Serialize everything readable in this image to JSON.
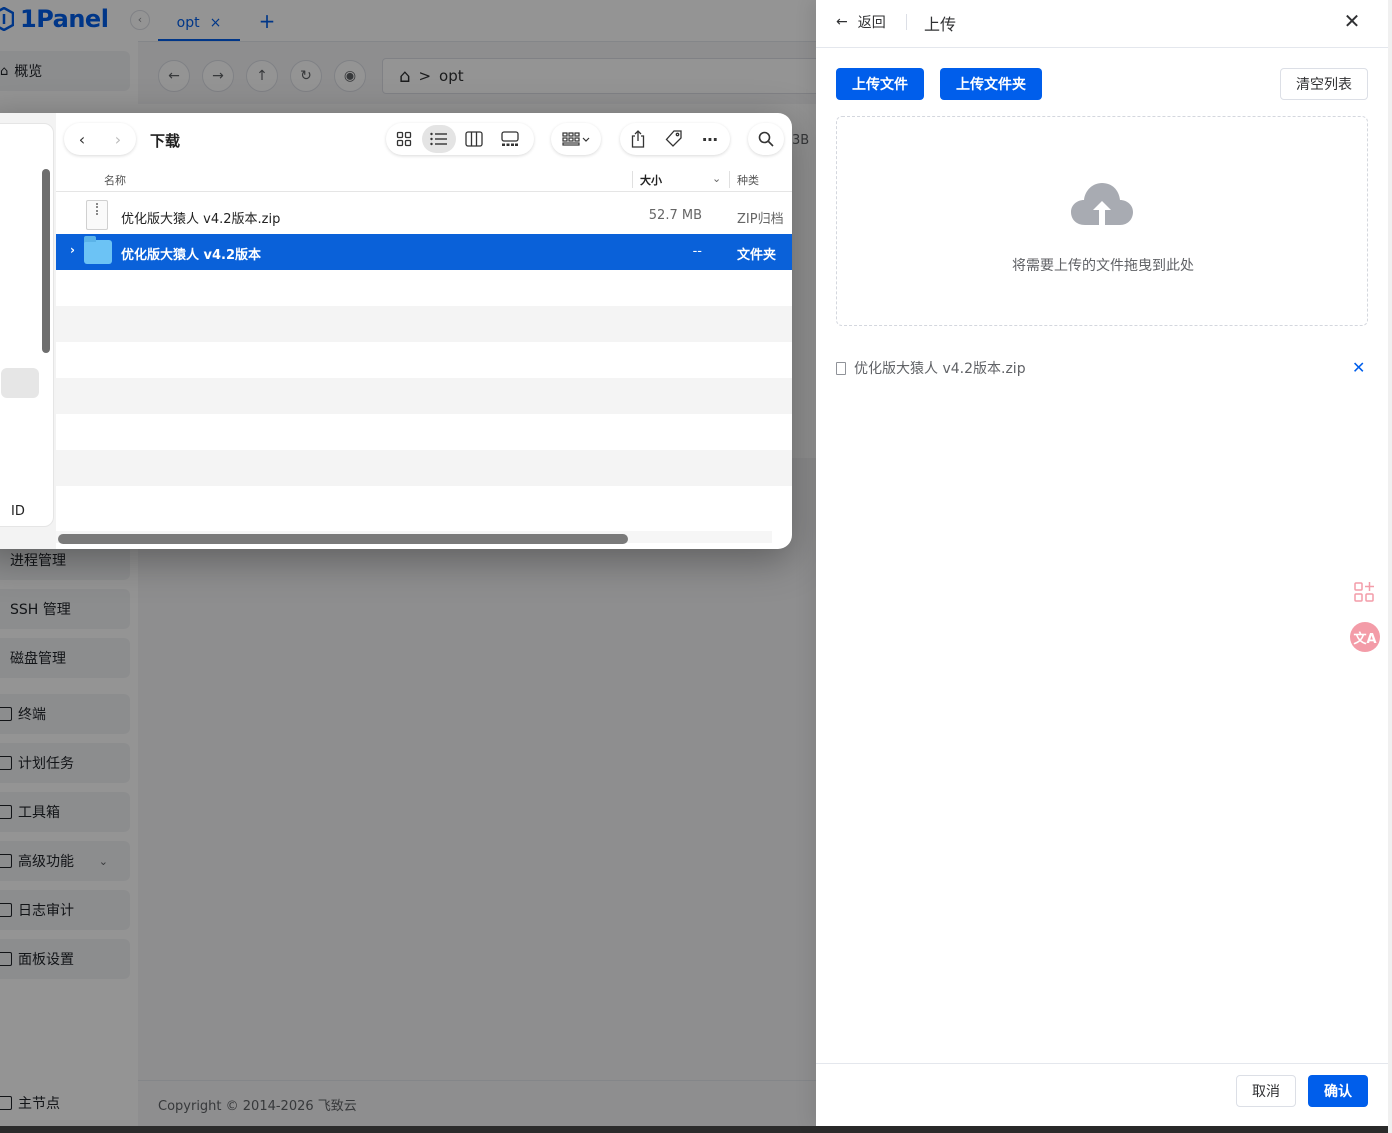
{
  "app": {
    "logo": "1Panel",
    "tab": {
      "label": "opt",
      "close": "×"
    },
    "tab_add": "+",
    "path": {
      "home": "⌂",
      "separator": ">",
      "folder": "opt"
    },
    "footer": "Copyright © 2014-2026 飞致云",
    "sidebar": {
      "overview": "概览",
      "process": "进程管理",
      "ssh": "SSH 管理",
      "disk": "磁盘管理",
      "terminal": "终端",
      "cron": "计划任务",
      "toolbox": "工具箱",
      "advanced": "高级功能",
      "log_audit": "日志审计",
      "settings": "面板设置",
      "master_node": "主节点"
    },
    "peek_size": "3B"
  },
  "finder": {
    "title": "下载",
    "sidebar_fragment": "ID",
    "columns": {
      "name": "名称",
      "size": "大小",
      "kind": "种类"
    },
    "rows": [
      {
        "name": "优化版大猿人 v4.2版本.zip",
        "size": "52.7 MB",
        "kind": "ZIP归档"
      },
      {
        "name": "优化版大猿人 v4.2版本",
        "size": "--",
        "kind": "文件夹"
      }
    ]
  },
  "drawer": {
    "back": "返回",
    "title": "上传",
    "upload_file": "上传文件",
    "upload_folder": "上传文件夹",
    "clear_list": "清空列表",
    "drop_hint": "将需要上传的文件拖曳到此处",
    "files": [
      {
        "name": "优化版大猿人 v4.2版本.zip"
      }
    ],
    "cancel": "取消",
    "confirm": "确认"
  },
  "colors": {
    "brand": "#005eeb",
    "selection": "#0a61d9"
  }
}
